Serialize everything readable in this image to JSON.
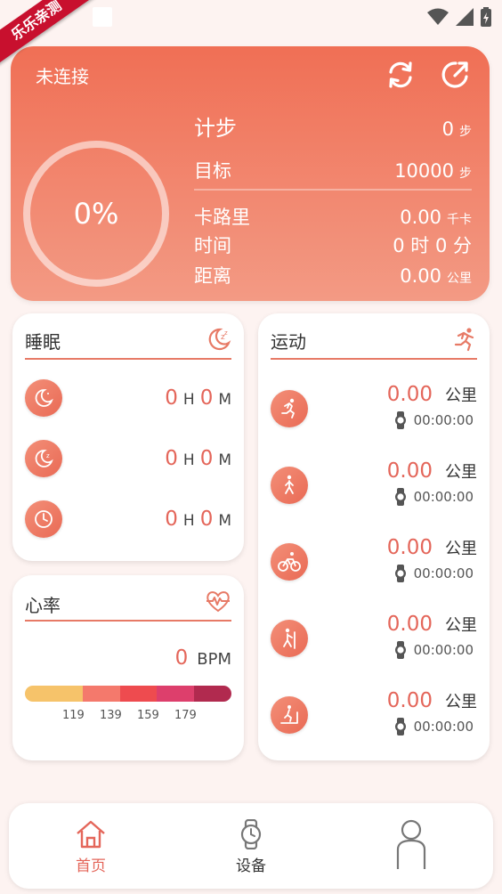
{
  "watermark": "乐乐亲测",
  "header": {
    "connection_status": "未连接"
  },
  "summary": {
    "progress_percent": "0%",
    "steps": {
      "label": "计步",
      "value": "0",
      "unit": "步"
    },
    "goal": {
      "label": "目标",
      "value": "10000",
      "unit": "步"
    },
    "calories": {
      "label": "卡路里",
      "value": "0.00",
      "unit": "千卡"
    },
    "time": {
      "label": "时间",
      "value": "0 时 0 分"
    },
    "distance": {
      "label": "距离",
      "value": "0.00",
      "unit": "公里"
    }
  },
  "sleep": {
    "title": "睡眠",
    "rows": [
      {
        "hours": "0",
        "h_unit": "H",
        "minutes": "0",
        "m_unit": "M"
      },
      {
        "hours": "0",
        "h_unit": "H",
        "minutes": "0",
        "m_unit": "M"
      },
      {
        "hours": "0",
        "h_unit": "H",
        "minutes": "0",
        "m_unit": "M"
      }
    ]
  },
  "heart_rate": {
    "title": "心率",
    "value": "0",
    "unit": "BPM",
    "ticks": [
      "119",
      "139",
      "159",
      "179"
    ],
    "zone_colors": [
      "#f6c36a",
      "#f4796c",
      "#ee4b4f",
      "#dd3f6c",
      "#b12a4f"
    ]
  },
  "sport": {
    "title": "运动",
    "rows": [
      {
        "icon": "running-icon",
        "distance": "0.00",
        "unit": "公里",
        "time": "00:00:00"
      },
      {
        "icon": "walking-icon",
        "distance": "0.00",
        "unit": "公里",
        "time": "00:00:00"
      },
      {
        "icon": "cycling-icon",
        "distance": "0.00",
        "unit": "公里",
        "time": "00:00:00"
      },
      {
        "icon": "climbing-icon",
        "distance": "0.00",
        "unit": "公里",
        "time": "00:00:00"
      },
      {
        "icon": "treadmill-icon",
        "distance": "0.00",
        "unit": "公里",
        "time": "00:00:00"
      }
    ]
  },
  "nav": {
    "home": "首页",
    "device": "设备",
    "profile": ""
  },
  "colors": {
    "accent": "#e4665a",
    "hero_top": "#f06f55",
    "hero_bottom": "#f39a84"
  }
}
